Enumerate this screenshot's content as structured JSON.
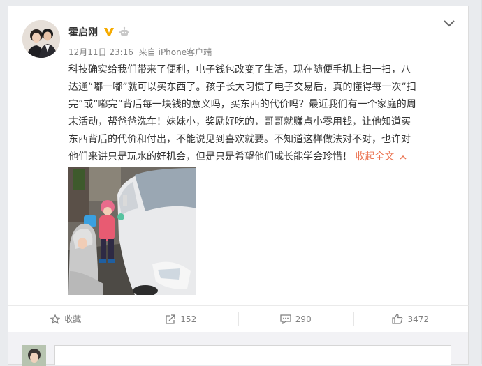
{
  "post": {
    "author": "霍启刚",
    "meta": {
      "date": "12月11日 23:16",
      "from_label": "来自",
      "source": "iPhone客户端"
    },
    "text_lines": [
      "科技确实给我们带来了便利，电子钱包改变了生活，现在随便手机上扫一扫，八",
      "达通“嘟一嘟”就可以买东西了。孩子长大习惯了电子交易后，真的懂得每一次“扫",
      "完”或“嘟完”背后每一块钱的意义吗，买东西的代价吗？最近我们有一个家庭的周",
      "末活动，帮爸爸洗车！妹妹小，奖励好吃的，哥哥就赚点小零用钱，让他知道买",
      "东西背后的代价和付出，不能说见到喜欢就要。不知道这样做法对不对，也许对",
      "他们来讲只是玩水的好机会，但是只是希望他们成长能学会珍惜！"
    ],
    "collapse_label": "收起全文"
  },
  "actions": {
    "favorite_label": "收藏",
    "repost_count": "152",
    "comment_count": "290",
    "like_count": "3472"
  },
  "comment_box": {
    "placeholder": ""
  },
  "colors": {
    "link": "#eb7350",
    "verified_badge": "#f6ab00",
    "meta_text": "#808080"
  }
}
